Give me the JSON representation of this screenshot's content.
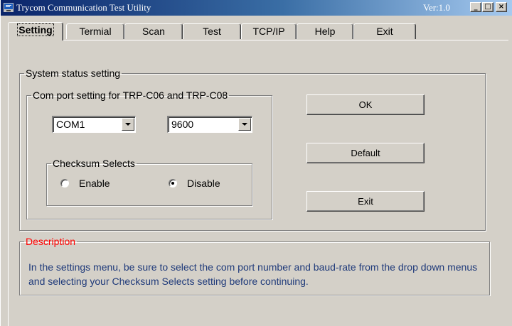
{
  "window": {
    "title": "Trycom Communication Test Utility",
    "version": "Ver:1.0",
    "controls": {
      "minimize": "_",
      "maximize": "□",
      "close": "×"
    }
  },
  "tabs": [
    {
      "label": "Setting",
      "active": true
    },
    {
      "label": "Termial",
      "active": false
    },
    {
      "label": "Scan",
      "active": false
    },
    {
      "label": "Test",
      "active": false
    },
    {
      "label": "TCP/IP",
      "active": false
    },
    {
      "label": "Help",
      "active": false
    },
    {
      "label": "Exit",
      "active": false
    }
  ],
  "system_status": {
    "legend": "System status setting",
    "com_port_group": {
      "legend": "Com port setting for TRP-C06 and TRP-C08",
      "port_value": "COM1",
      "baud_value": "9600"
    },
    "checksum_group": {
      "legend": "Checksum Selects",
      "enable_label": "Enable",
      "disable_label": "Disable",
      "selected": "Disable"
    },
    "buttons": {
      "ok": "OK",
      "default": "Default",
      "exit": "Exit"
    }
  },
  "description": {
    "legend": "Description",
    "text": "In the settings menu, be sure to select the com port number and baud-rate from the drop down menus and selecting your Checksum Selects setting before continuing."
  },
  "colors": {
    "face": "#d4d0c8",
    "title_start": "#0a246a",
    "title_end": "#a6caf0",
    "description_legend": "#ff0000",
    "description_text": "#1f3a7a"
  }
}
